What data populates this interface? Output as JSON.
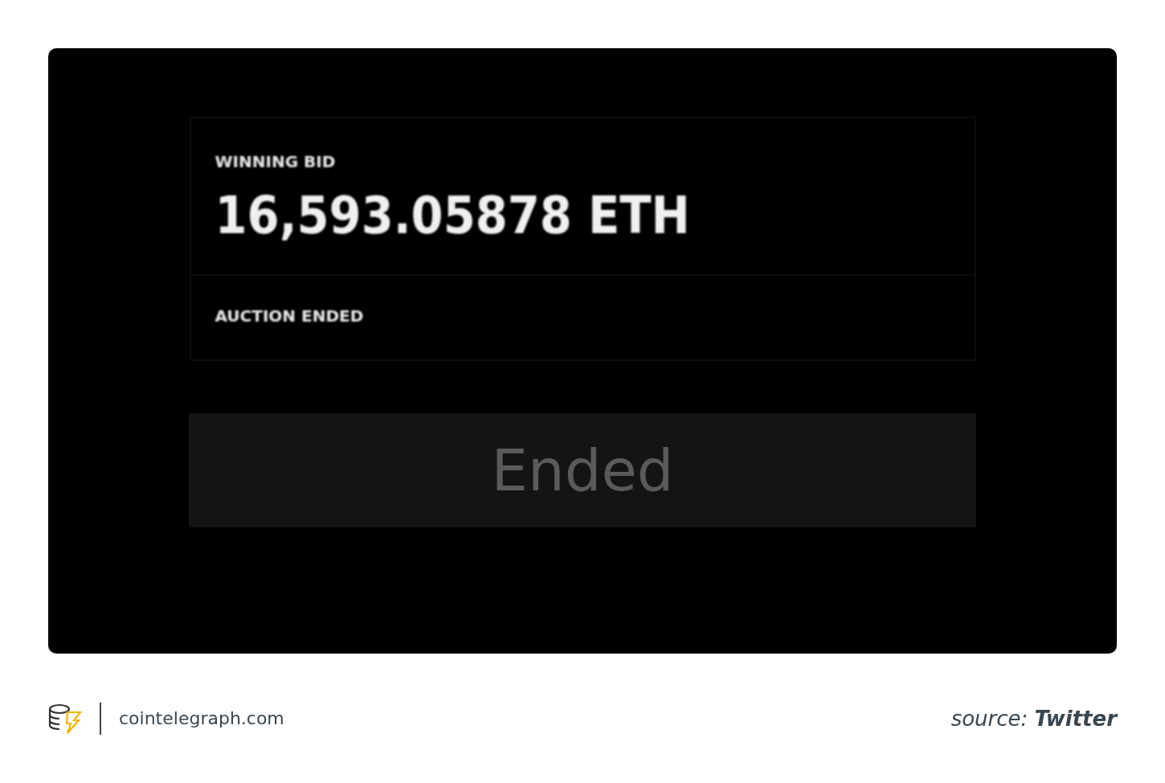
{
  "auction": {
    "bid_label": "WINNING BID",
    "bid_amount": "16,593.05878 ETH",
    "status": "AUCTION ENDED"
  },
  "button": {
    "label": "Ended",
    "disabled": true
  },
  "footer": {
    "site": "cointelegraph.com",
    "source": "source: **Twitter**"
  }
}
